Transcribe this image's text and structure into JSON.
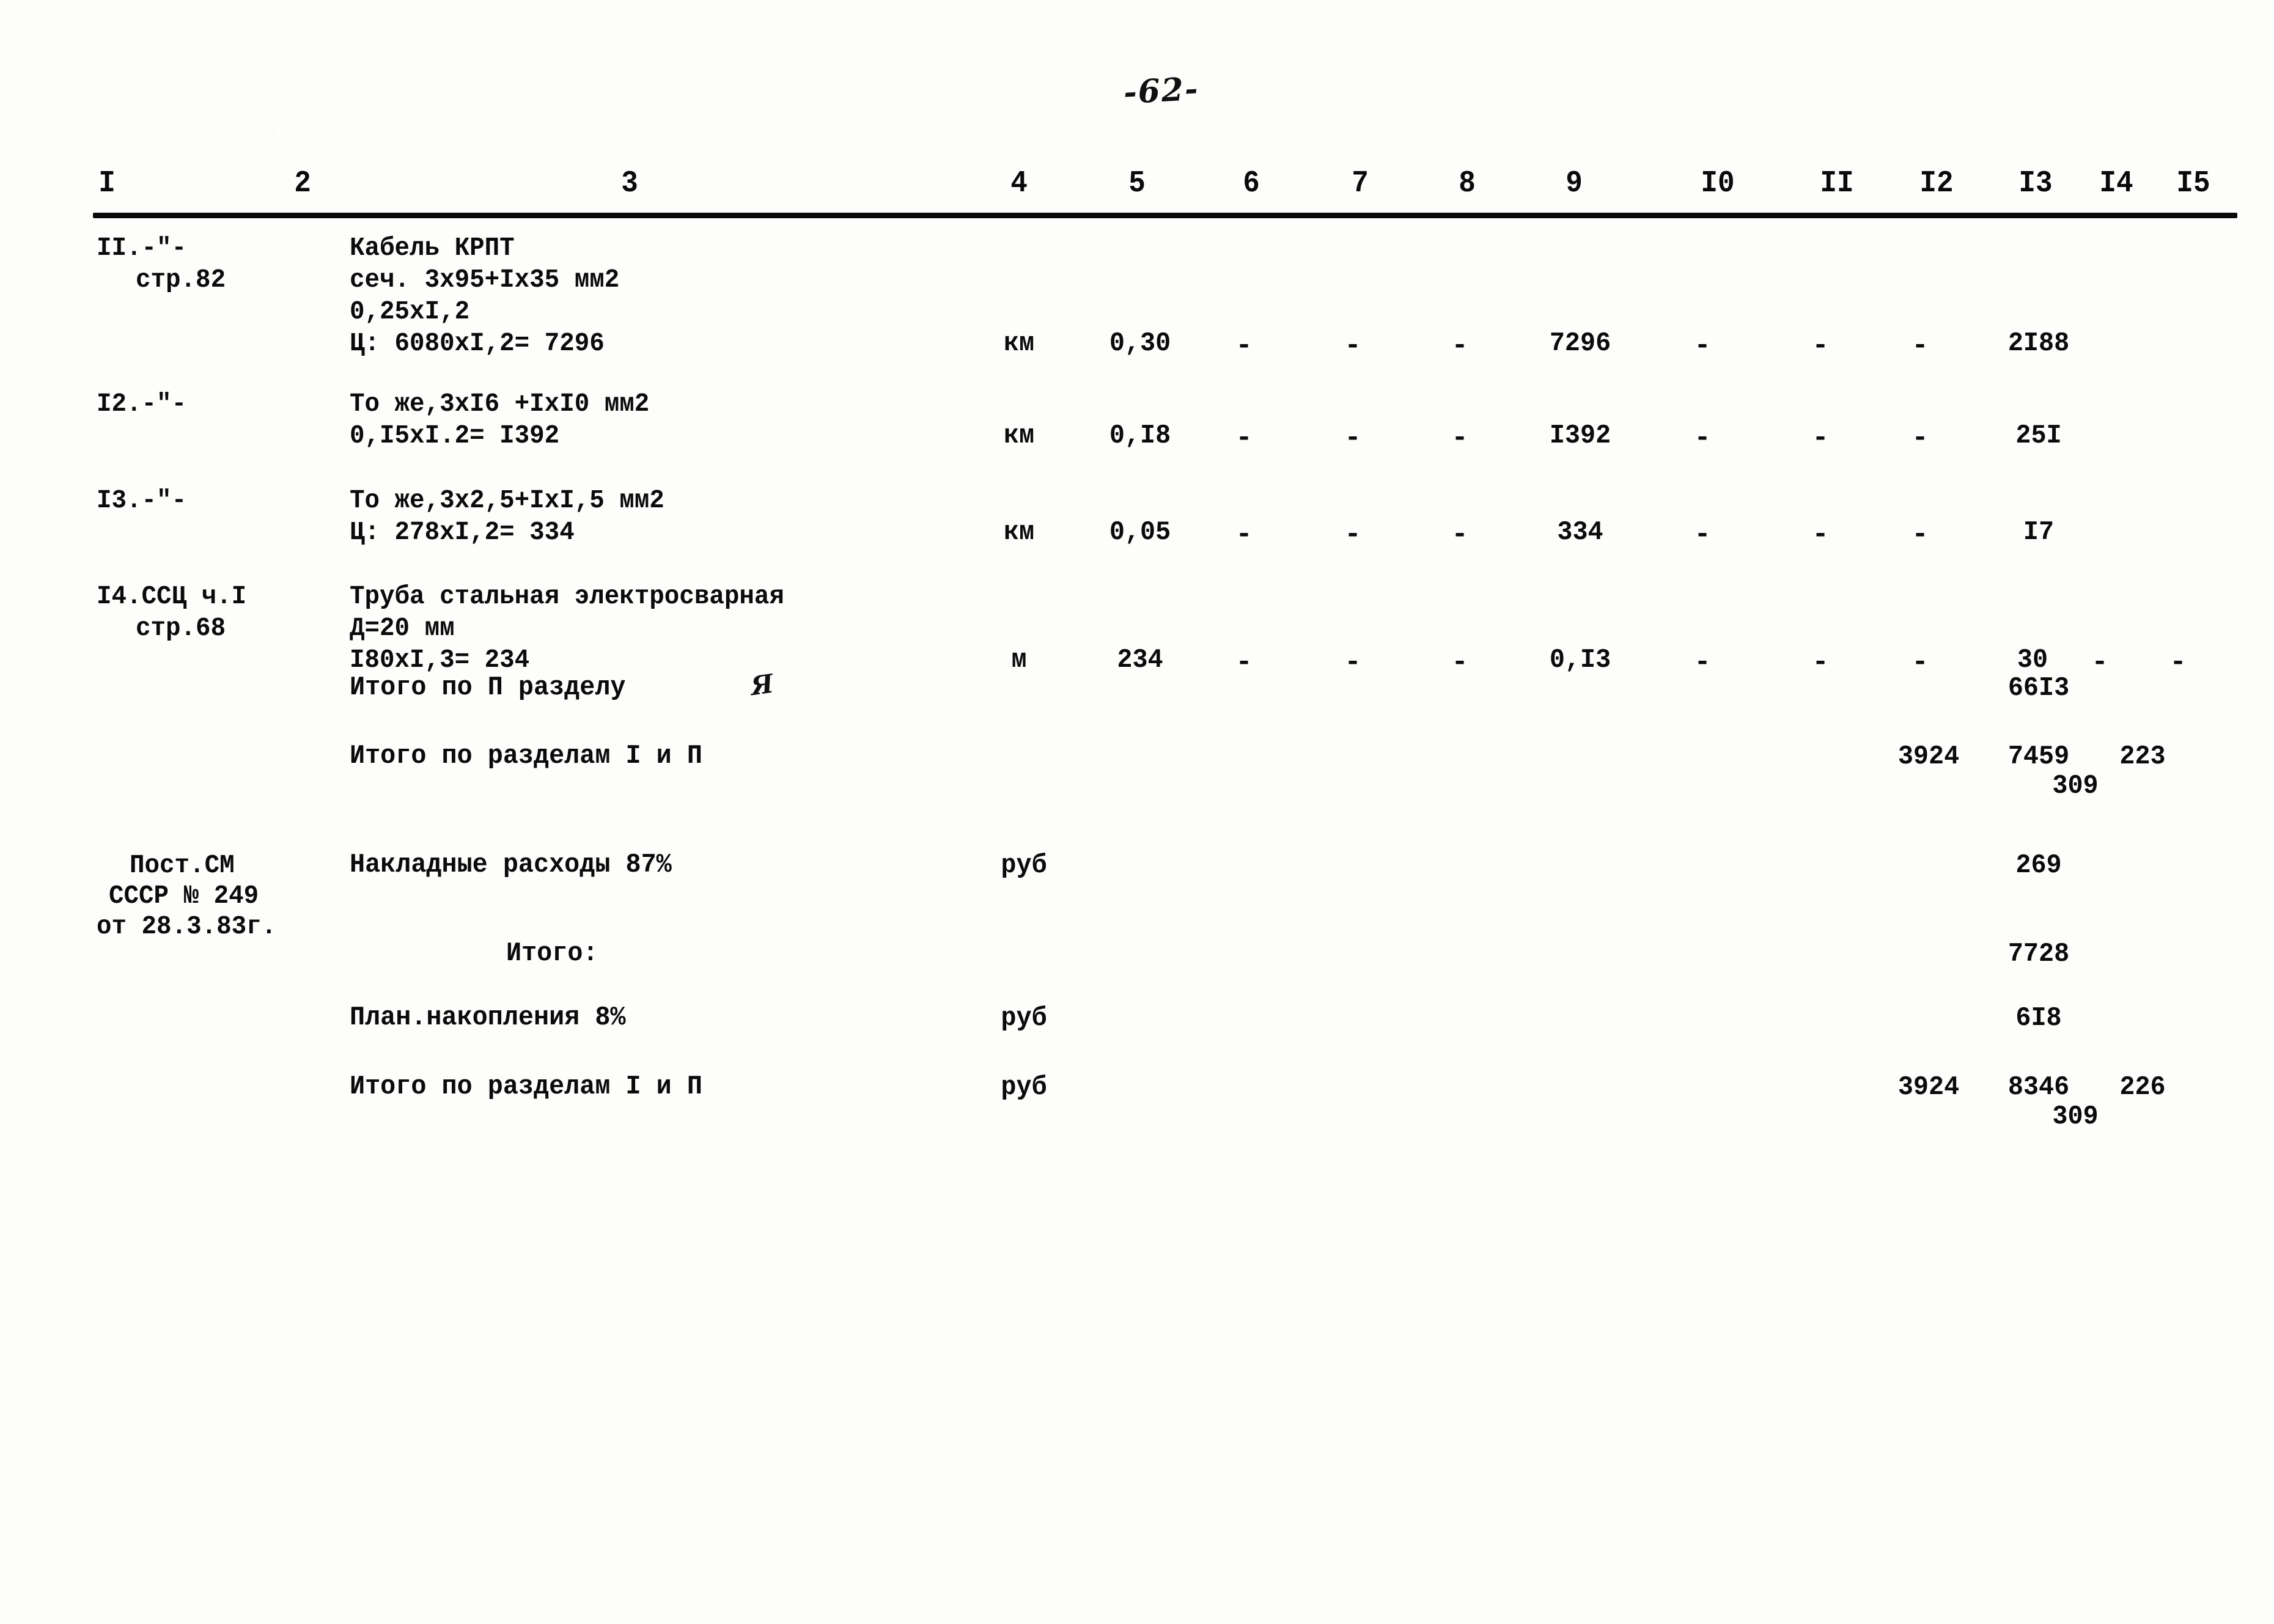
{
  "document": {
    "page_number": "-62-",
    "kind": "construction-cost-estimate-sheet"
  },
  "table": {
    "column_headers": [
      "I",
      "2",
      "3",
      "4",
      "5",
      "6",
      "7",
      "8",
      "9",
      "I0",
      "II",
      "I2",
      "I3",
      "I4",
      "I5"
    ],
    "rows": [
      {
        "id": "row-11",
        "ref_lines": [
          "II.-\"-",
          "стр.82"
        ],
        "desc_lines": [
          "Кабель КРПТ",
          "сеч. 3х95+Iх35 мм2",
          "0,25хI,2",
          "Ц: 6080хI,2= 7296"
        ],
        "unit": "км",
        "qty": "0,30",
        "c6": "-",
        "c7": "-",
        "c8": "-",
        "c9": "7296",
        "c10": "-",
        "c11": "-",
        "c12": "-",
        "c13": "2I88",
        "c14": "",
        "c15": ""
      },
      {
        "id": "row-12",
        "ref_lines": [
          "I2.-\"-"
        ],
        "desc_lines": [
          "То же,3хI6 +IхI0 мм2",
          "0,I5хI.2= I392"
        ],
        "unit": "км",
        "qty": "0,I8",
        "c6": "-",
        "c7": "-",
        "c8": "-",
        "c9": "I392",
        "c10": "-",
        "c11": "-",
        "c12": "-",
        "c13": "25I",
        "c14": "",
        "c15": ""
      },
      {
        "id": "row-13",
        "ref_lines": [
          "I3.-\"-"
        ],
        "desc_lines": [
          "То же,3х2,5+IхI,5 мм2",
          "Ц: 278хI,2= 334"
        ],
        "unit": "км",
        "qty": "0,05",
        "c6": "-",
        "c7": "-",
        "c8": "-",
        "c9": "334",
        "c10": "-",
        "c11": "-",
        "c12": "-",
        "c13": "I7",
        "c14": "",
        "c15": ""
      },
      {
        "id": "row-14",
        "ref_lines": [
          "I4.ССЦ ч.I",
          "стр.68"
        ],
        "desc_lines": [
          "Труба стальная электросварная",
          "Д=20 мм",
          "I80хI,3= 234"
        ],
        "unit": "м",
        "qty": "234",
        "c6": "-",
        "c7": "-",
        "c8": "-",
        "c9": "0,I3",
        "c10": "-",
        "c11": "-",
        "c12": "-",
        "c13": "30",
        "c14": "-",
        "c15": "-"
      }
    ],
    "summary_rows": [
      {
        "id": "summary-section2",
        "label": "Итого по П разделу",
        "hand_mark": "Я",
        "unit": "",
        "c12": "",
        "c13": "66I3",
        "c13_sub": "",
        "c15": ""
      },
      {
        "id": "summary-sections-1-2",
        "label": "Итого по разделам I и П",
        "hand_mark": "",
        "unit": "",
        "c12": "3924",
        "c13": "7459",
        "c13_sub": "309",
        "c15": "223"
      },
      {
        "id": "overhead",
        "label": "Накладные расходы 87%",
        "hand_mark": "",
        "unit": "руб",
        "c12": "",
        "c13": "269",
        "c13_sub": "",
        "c15": ""
      },
      {
        "id": "subtotal",
        "label": "Итого:",
        "hand_mark": "",
        "unit": "",
        "c12": "",
        "c13": "7728",
        "c13_sub": "",
        "c15": ""
      },
      {
        "id": "planned-savings",
        "label": "План.накопления 8%",
        "hand_mark": "",
        "unit": "руб",
        "c12": "",
        "c13": "6I8",
        "c13_sub": "",
        "c15": ""
      },
      {
        "id": "grand-total",
        "label": "Итого по разделам I и П",
        "hand_mark": "",
        "unit": "руб",
        "c12": "3924",
        "c13": "8346",
        "c13_sub": "309",
        "c15": "226"
      }
    ],
    "regulation_note_lines": [
      "Пост.СМ",
      "СССР № 249",
      "от 28.3.83г."
    ]
  }
}
